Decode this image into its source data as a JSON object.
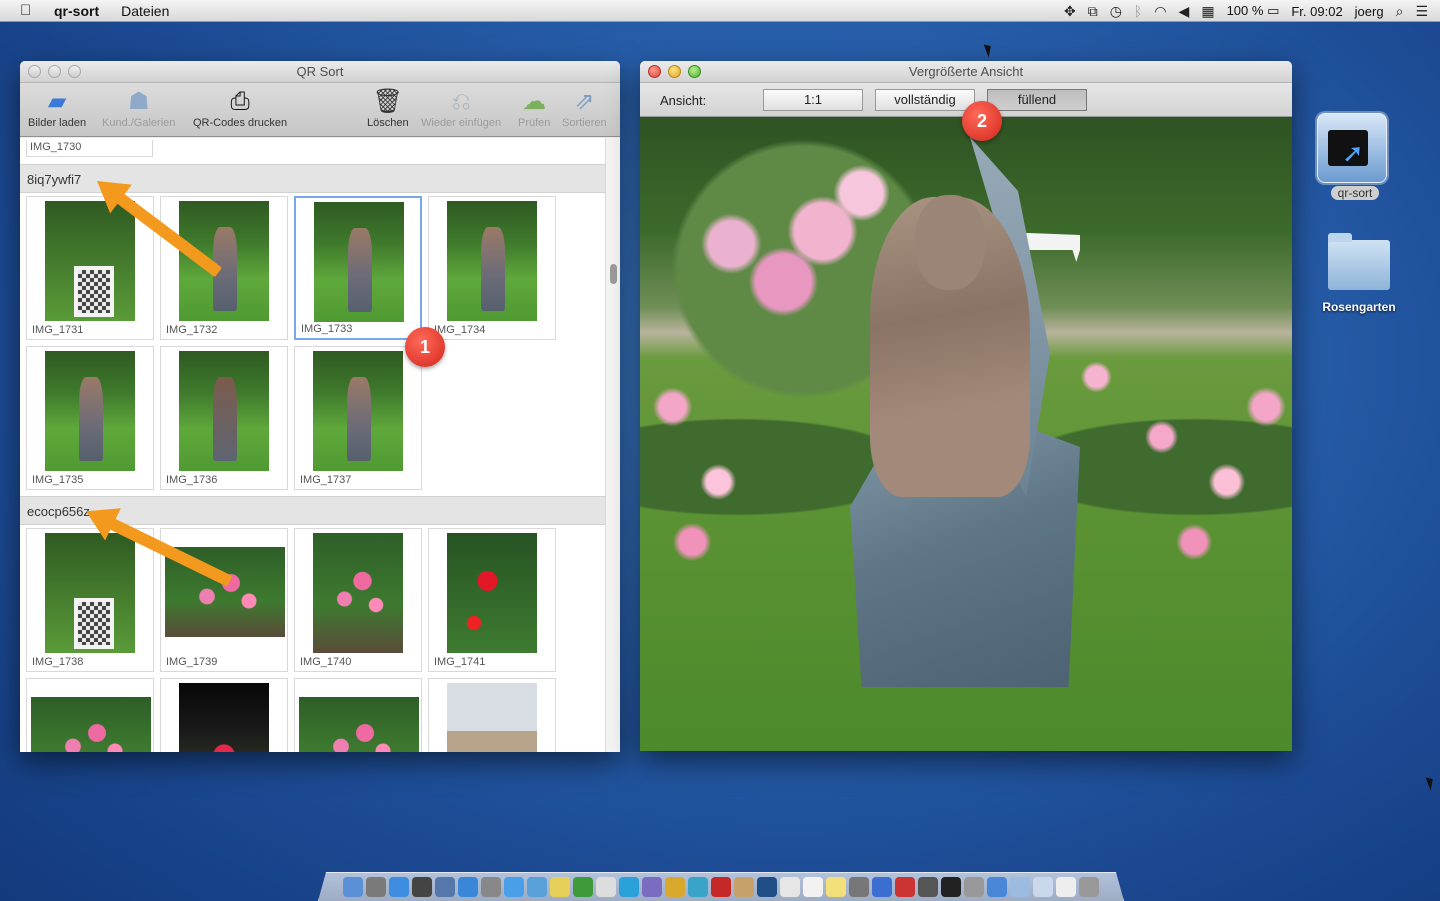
{
  "menubar": {
    "apple": "",
    "app_name": "qr-sort",
    "menus": [
      "Dateien"
    ],
    "status_icons": [
      "dropbox-icon",
      "window-icon",
      "timemachine-icon",
      "bluetooth-icon",
      "wifi-icon",
      "volume-icon",
      "calendar-icon"
    ],
    "battery": "100 %",
    "clock": "Fr. 09:02",
    "user": "joerg"
  },
  "left_window": {
    "title": "QR Sort",
    "toolbar": [
      {
        "id": "load",
        "label": "Bilder laden",
        "icon": "folder-icon",
        "enabled": true
      },
      {
        "id": "customers",
        "label": "Kund./Galerien",
        "icon": "people-icon",
        "enabled": false
      },
      {
        "id": "print",
        "label": "QR-Codes drucken",
        "icon": "printer-icon",
        "enabled": true
      },
      {
        "id": "delete",
        "label": "Löschen",
        "icon": "trash-icon",
        "enabled": true
      },
      {
        "id": "reinsert",
        "label": "Wieder einfügen",
        "icon": "restore-icon",
        "enabled": false
      },
      {
        "id": "check",
        "label": "Prüfen",
        "icon": "check-cloud-icon",
        "enabled": false
      },
      {
        "id": "sort",
        "label": "Sortieren",
        "icon": "sort-icon",
        "enabled": false
      }
    ],
    "previous_caption": "IMG_1730",
    "groups": [
      {
        "name": "8iq7ywfi7",
        "images": [
          "IMG_1731",
          "IMG_1732",
          "IMG_1733",
          "IMG_1734",
          "IMG_1735",
          "IMG_1736",
          "IMG_1737"
        ]
      },
      {
        "name": "ecocp656z",
        "images": [
          "IMG_1738",
          "IMG_1739",
          "IMG_1740",
          "IMG_1741"
        ]
      }
    ],
    "selected_image": "IMG_1733"
  },
  "right_window": {
    "title": "Vergrößerte Ansicht",
    "view_label": "Ansicht:",
    "view_buttons": [
      "1:1",
      "vollständig",
      "füllend"
    ],
    "active_view": "füllend"
  },
  "annotations": {
    "badge1": "1",
    "badge2": "2",
    "arrow_color": "#f39a1e",
    "badge_color": "#d3261b"
  },
  "desktop": {
    "icons": [
      {
        "label": "qr-sort",
        "icon": "qr-sort-app-icon"
      },
      {
        "label": "Rosengarten",
        "icon": "folder-icon"
      }
    ]
  },
  "dock": {
    "icons": [
      "finder-icon",
      "launchpad-icon",
      "safari-icon",
      "dashboard-icon",
      "preview-icon",
      "appstore-icon",
      "system-prefs-icon",
      "messages-icon",
      "mail-icon",
      "notes-icon",
      "tree-icon",
      "globe-icon",
      "skype-icon",
      "php-icon",
      "database-icon",
      "network-icon",
      "filezilla-icon",
      "books-icon",
      "photoshop-icon",
      "calendar-icon",
      "textedit-icon",
      "stickies-icon",
      "photos-icon",
      "itunes-icon",
      "flashcard-icon",
      "terminal-icon",
      "activity-icon",
      "font-icon",
      "qr-sort-icon",
      "folder-icon",
      "documents-icon",
      "file-icon",
      "trash-icon"
    ]
  }
}
